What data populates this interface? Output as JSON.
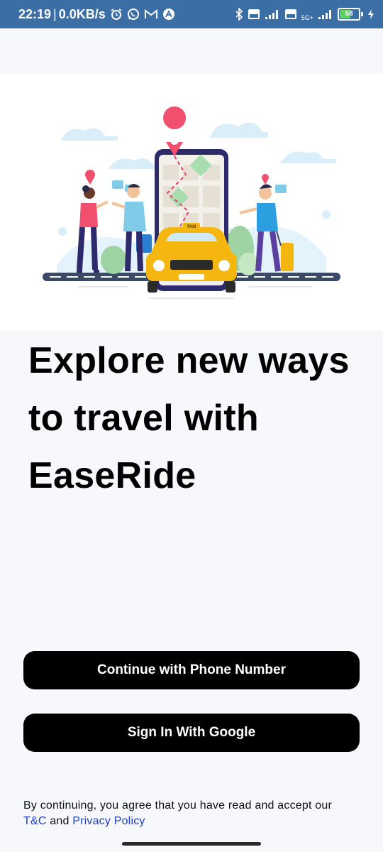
{
  "status_bar": {
    "time": "22:19",
    "separator": "|",
    "net_speed": "0.0KB/s",
    "network_label": "5G+",
    "battery": "58"
  },
  "illustration": {
    "taxi_sign": "TAXI"
  },
  "headline": "Explore new ways to travel with EaseRide",
  "buttons": {
    "phone": "Continue with Phone Number",
    "google": "Sign In With Google"
  },
  "terms": {
    "prefix": "By continuing, you agree that you have read and accept our",
    "tc_link": "T&C",
    "and": "and",
    "privacy_link": "Privacy Policy"
  },
  "colors": {
    "status_bar": "#3b6ea5",
    "background": "#f7f8fc",
    "button": "#000000",
    "link": "#1f3fbf",
    "taxi": "#f5b70f",
    "phone_frame": "#2c2a6b",
    "pin": "#f0506e"
  }
}
